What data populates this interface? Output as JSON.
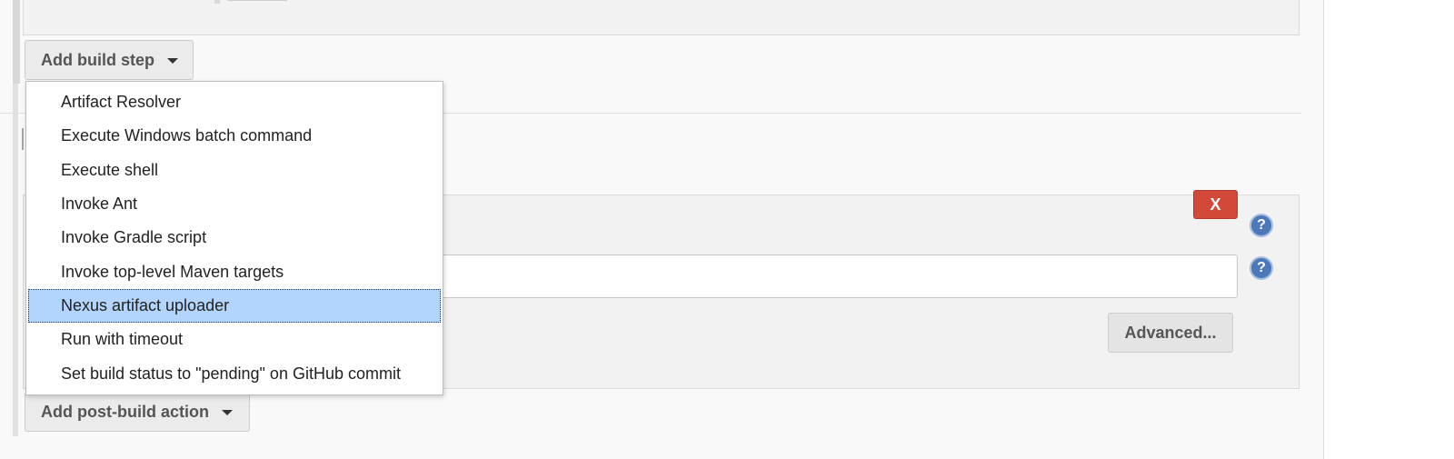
{
  "build_step": {
    "add_button_label": "Add build step",
    "menu_items": [
      "Artifact Resolver",
      "Execute Windows batch command",
      "Execute shell",
      "Invoke Ant",
      "Invoke Gradle script",
      "Invoke top-level Maven targets",
      "Nexus artifact uploader",
      "Run with timeout",
      "Set build status to \"pending\" on GitHub commit"
    ],
    "selected_item": "Nexus artifact uploader"
  },
  "post_build": {
    "delete_label": "X",
    "help_glyph": "?",
    "advanced_label": "Advanced...",
    "input_value": "",
    "add_button_label": "Add post-build action"
  },
  "colors": {
    "selected_highlight": "#b3d4fc",
    "delete_button": "#d24939",
    "help_icon": "#4a78b8"
  },
  "icons": [
    "chevron-down-icon",
    "help-icon"
  ]
}
